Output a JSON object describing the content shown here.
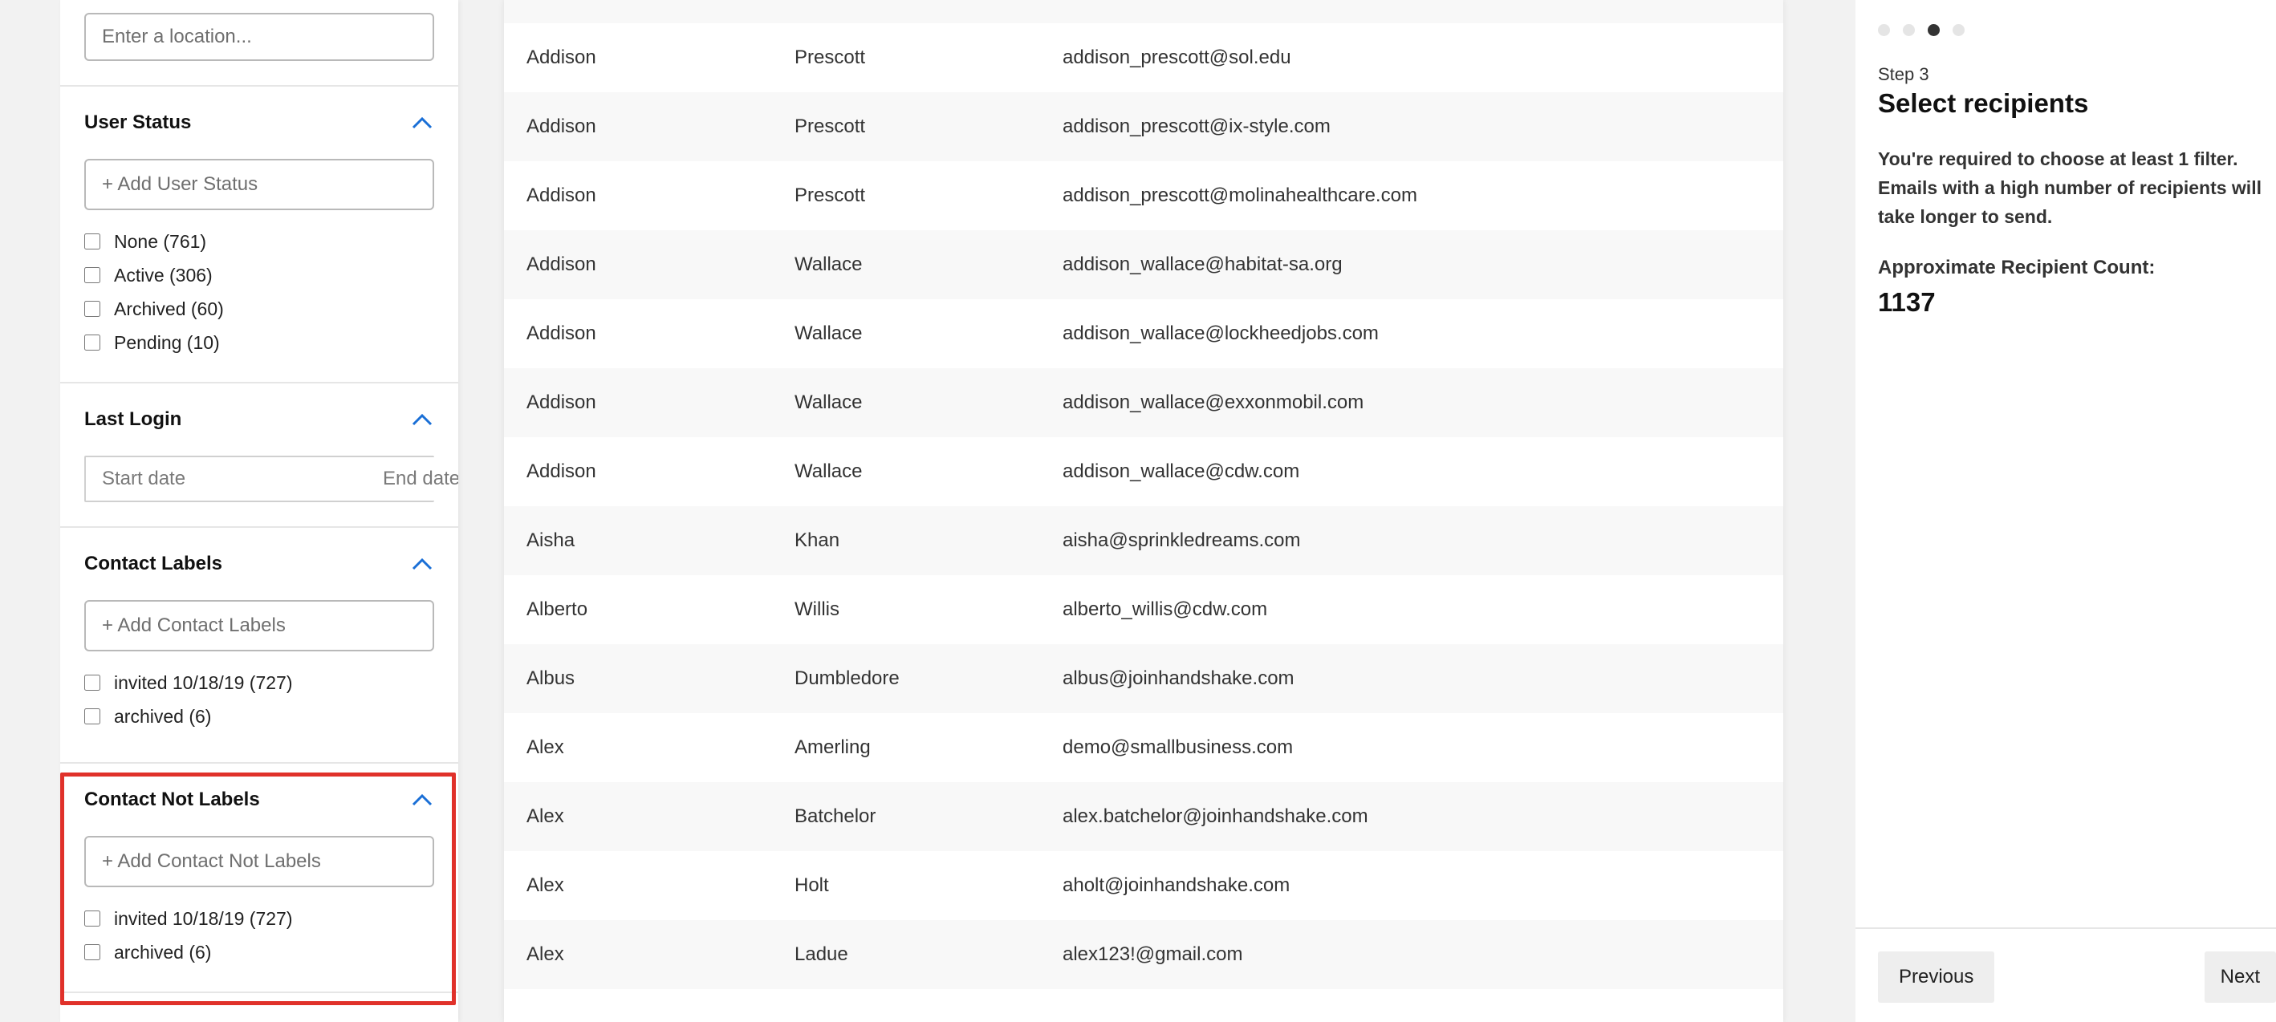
{
  "filters": {
    "location_placeholder": "Enter a location...",
    "user_status": {
      "title": "User Status",
      "placeholder": "+ Add User Status",
      "options": [
        "None (761)",
        "Active (306)",
        "Archived (60)",
        "Pending (10)"
      ]
    },
    "last_login": {
      "title": "Last Login",
      "start_placeholder": "Start date",
      "end_placeholder": "End date"
    },
    "contact_labels": {
      "title": "Contact Labels",
      "placeholder": "+ Add Contact Labels",
      "options": [
        "invited 10/18/19 (727)",
        "archived (6)"
      ]
    },
    "contact_not_labels": {
      "title": "Contact Not Labels",
      "placeholder": "+ Add Contact Not Labels",
      "options": [
        "invited 10/18/19 (727)",
        "archived (6)"
      ]
    },
    "accent_color": "#1a6fd6",
    "highlight_color": "#e0312a"
  },
  "table": {
    "rows": [
      [
        "Addison",
        "Prescott",
        "addison_prescott@sol.edu"
      ],
      [
        "Addison",
        "Prescott",
        "addison_prescott@ix-style.com"
      ],
      [
        "Addison",
        "Prescott",
        "addison_prescott@molinahealthcare.com"
      ],
      [
        "Addison",
        "Wallace",
        "addison_wallace@habitat-sa.org"
      ],
      [
        "Addison",
        "Wallace",
        "addison_wallace@lockheedjobs.com"
      ],
      [
        "Addison",
        "Wallace",
        "addison_wallace@exxonmobil.com"
      ],
      [
        "Addison",
        "Wallace",
        "addison_wallace@cdw.com"
      ],
      [
        "Aisha",
        "Khan",
        "aisha@sprinkledreams.com"
      ],
      [
        "Alberto",
        "Willis",
        "alberto_willis@cdw.com"
      ],
      [
        "Albus",
        "Dumbledore",
        "albus@joinhandshake.com"
      ],
      [
        "Alex",
        "Amerling",
        "demo@smallbusiness.com"
      ],
      [
        "Alex",
        "Batchelor",
        "alex.batchelor@joinhandshake.com"
      ],
      [
        "Alex",
        "Holt",
        "aholt@joinhandshake.com"
      ],
      [
        "Alex",
        "Ladue",
        "alex123!@gmail.com"
      ]
    ]
  },
  "wizard": {
    "step_label": "Step 3",
    "title": "Select recipients",
    "description": "You're required to choose at least 1 filter. Emails with a high number of recipients will take longer to send.",
    "count_label": "Approximate Recipient Count:",
    "count_value": "1137",
    "previous_label": "Previous",
    "next_label": "Next",
    "current_step_index": 2,
    "total_steps": 4
  }
}
